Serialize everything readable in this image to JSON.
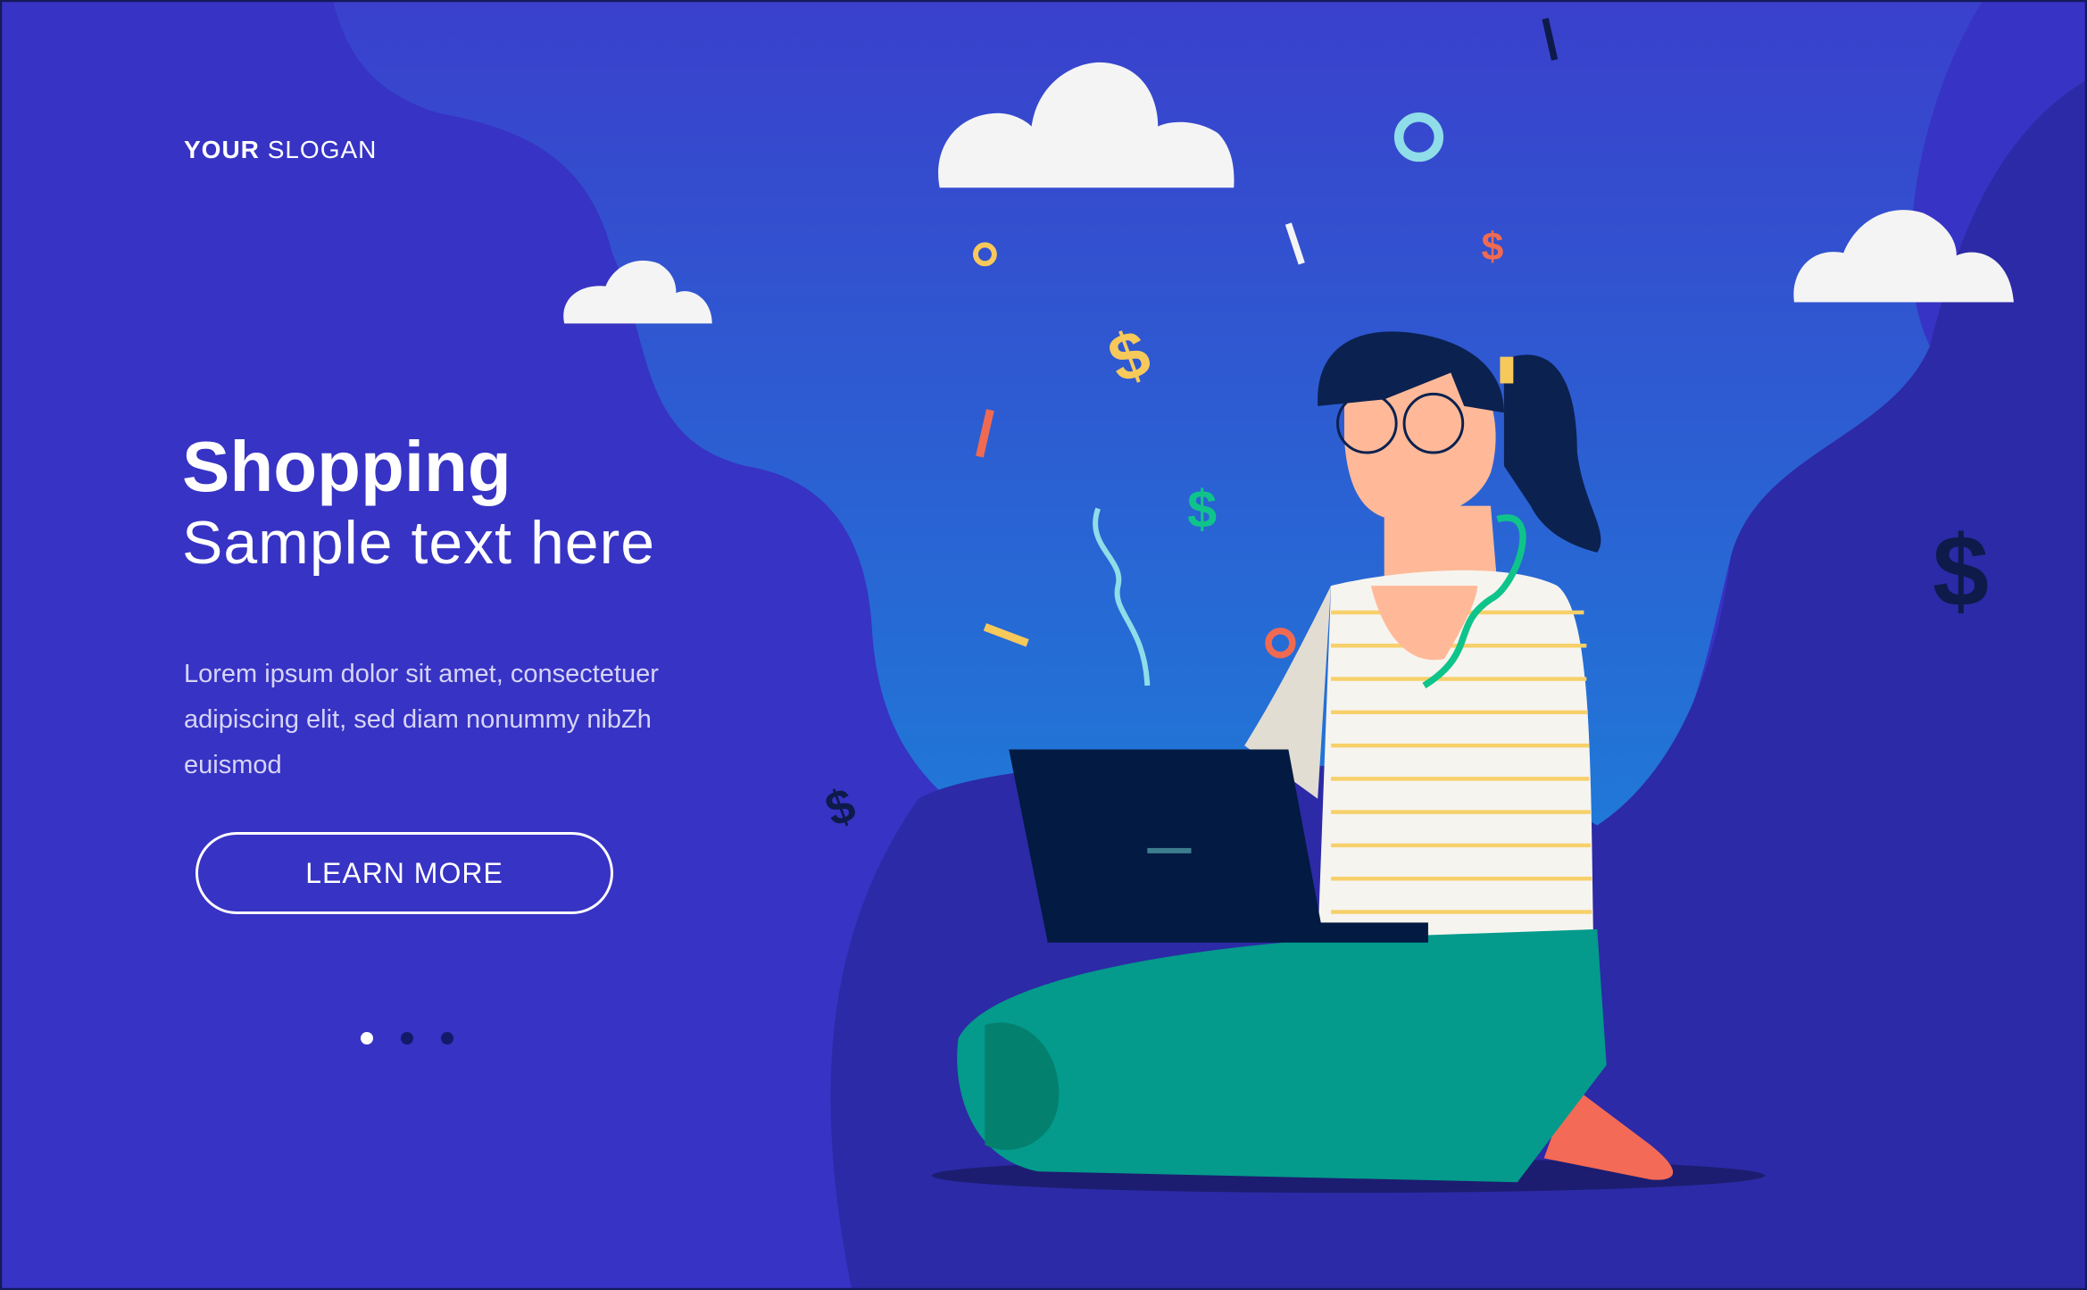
{
  "header": {
    "slogan_bold": "YOUR",
    "slogan_rest": "SLOGAN"
  },
  "hero": {
    "title": "Shopping",
    "subtitle": "Sample text here",
    "body": "Lorem ipsum dolor sit amet, consectetuer adipiscing elit, sed diam nonummy nibZh euismod",
    "cta_label": "LEARN MORE"
  },
  "carousel": {
    "slides": 3,
    "active_index": 0
  },
  "colors": {
    "background": "#3733c4",
    "blob": "#2f6fd6",
    "floor": "#2c2aa6",
    "accent_green": "#049a8c"
  }
}
